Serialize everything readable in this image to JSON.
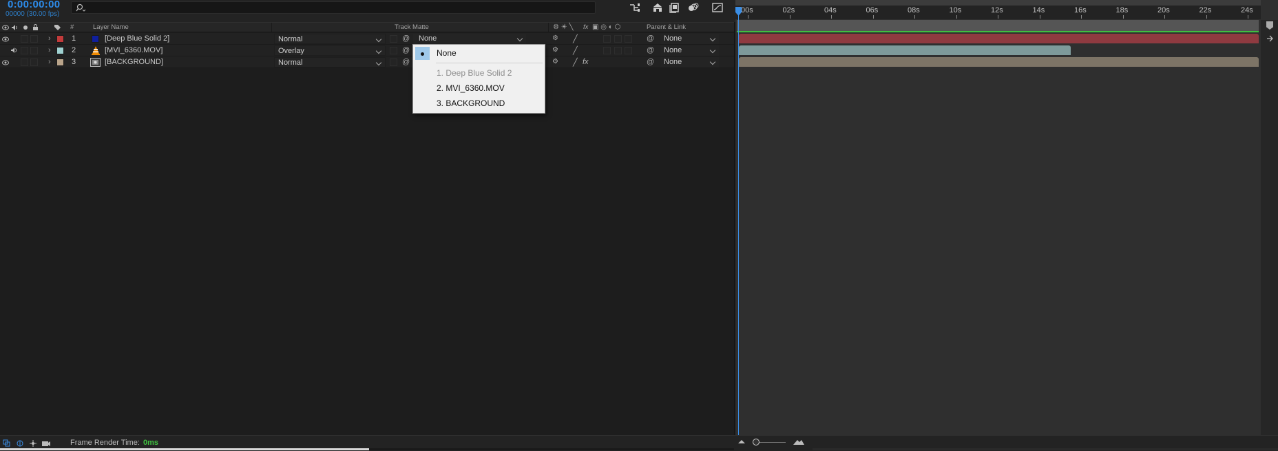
{
  "header": {
    "timecode": "0:00:00:00",
    "frames_fps": "00000 (30.00 fps)",
    "search_placeholder": ""
  },
  "columns": {
    "num": "#",
    "layer_name": "Layer Name",
    "track_matte": "Track Matte",
    "parent_link": "Parent & Link",
    "fx": "fx"
  },
  "layers": [
    {
      "num": "1",
      "name": "[Deep Blue Solid 2]",
      "label_color": "#c23b3b",
      "icon_color": "#0f1f9c",
      "blend": "Normal",
      "track_matte": "None",
      "parent": "None",
      "video": true,
      "audio": false
    },
    {
      "num": "2",
      "name": "[MVI_6360.MOV]",
      "label_color": "#9fd1d0",
      "icon": "vlc-cone-icon",
      "blend": "Overlay",
      "track_matte": "",
      "parent": "None",
      "video": false,
      "audio": true
    },
    {
      "num": "3",
      "name": "[BACKGROUND]",
      "label_color": "#b9a48a",
      "icon": "composition-icon",
      "blend": "Normal",
      "track_matte": "",
      "parent": "None",
      "video": true,
      "audio": false,
      "fx": "fx"
    }
  ],
  "dropdown": {
    "items": [
      {
        "label": "None",
        "selected": true,
        "disabled": false
      },
      {
        "label": "1. Deep Blue Solid 2",
        "selected": false,
        "disabled": true
      },
      {
        "label": "2. MVI_6360.MOV",
        "selected": false,
        "disabled": false
      },
      {
        "label": "3. BACKGROUND",
        "selected": false,
        "disabled": false
      }
    ]
  },
  "timeline": {
    "ticks": [
      "00s",
      "02s",
      "04s",
      "06s",
      "08s",
      "10s",
      "12s",
      "14s",
      "16s",
      "18s",
      "20s",
      "22s",
      "24s"
    ],
    "bar_colors": [
      "#8f3a40",
      "#7e9a9a",
      "#7d7466"
    ]
  },
  "footer": {
    "frame_render_label": "Frame Render Time:",
    "frame_render_value": "0ms"
  },
  "colors": {
    "accent_blue": "#2d8ceb",
    "green_line": "#3fbf3f"
  }
}
